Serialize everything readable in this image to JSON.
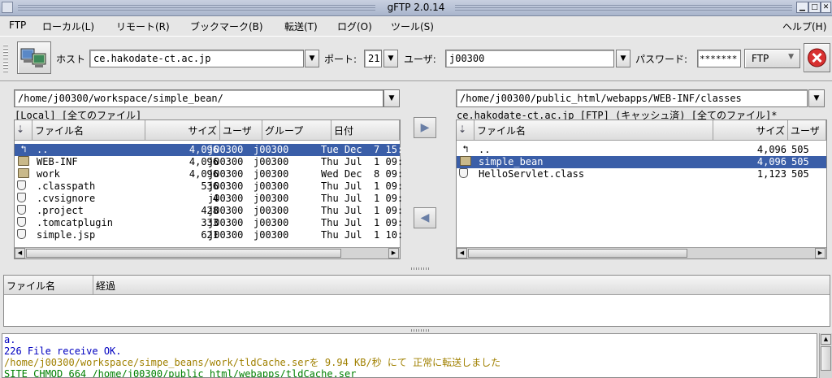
{
  "window": {
    "title": "gFTP 2.0.14"
  },
  "menu": [
    "FTP",
    "ローカル(L)",
    "リモート(R)",
    "ブックマーク(B)",
    "転送(T)",
    "ログ(O)",
    "ツール(S)",
    "ヘルプ(H)"
  ],
  "toolbar": {
    "host_label": "ホスト",
    "host": "ce.hakodate-ct.ac.jp",
    "port_label": "ポート:",
    "port": "21",
    "user_label": "ユーザ:",
    "user": "j00300",
    "password_label": "パスワード:",
    "password": "*******",
    "protocol": "FTP"
  },
  "local": {
    "path": "/home/j00300/workspace/simple_bean/",
    "status": "[Local] [全てのファイル]",
    "columns": [
      "ファイル名",
      "サイズ",
      "ユーザ",
      "グループ",
      "日付"
    ],
    "files": [
      {
        "icon": "up-dir-icon",
        "name": "..",
        "size": "4,096",
        "user": "j00300",
        "group": "j00300",
        "date": "Tue Dec  7 15:"
      },
      {
        "icon": "folder-icon",
        "name": "WEB-INF",
        "size": "4,096",
        "user": "j00300",
        "group": "j00300",
        "date": "Thu Jul  1 09:"
      },
      {
        "icon": "folder-icon",
        "name": "work",
        "size": "4,096",
        "user": "j00300",
        "group": "j00300",
        "date": "Wed Dec  8 09:"
      },
      {
        "icon": "file-icon",
        "name": ".classpath",
        "size": "536",
        "user": "j00300",
        "group": "j00300",
        "date": "Thu Jul  1 09:"
      },
      {
        "icon": "file-icon",
        "name": ".cvsignore",
        "size": "4",
        "user": "j00300",
        "group": "j00300",
        "date": "Thu Jul  1 09:"
      },
      {
        "icon": "file-icon",
        "name": ".project",
        "size": "428",
        "user": "j00300",
        "group": "j00300",
        "date": "Thu Jul  1 09:"
      },
      {
        "icon": "file-icon",
        "name": ".tomcatplugin",
        "size": "333",
        "user": "j00300",
        "group": "j00300",
        "date": "Thu Jul  1 09:"
      },
      {
        "icon": "file-icon",
        "name": "simple.jsp",
        "size": "621",
        "user": "j00300",
        "group": "j00300",
        "date": "Thu Jul  1 10:"
      }
    ]
  },
  "remote": {
    "path": "/home/j00300/public_html/webapps/WEB-INF/classes",
    "status": "ce.hakodate-ct.ac.jp [FTP] (キャッシュ済) [全てのファイル]*",
    "columns": [
      "ファイル名",
      "サイズ",
      "ユーザ"
    ],
    "files": [
      {
        "icon": "up-dir-icon",
        "name": "..",
        "size": "4,096",
        "user": "505"
      },
      {
        "icon": "folder-icon",
        "name": "simple_bean",
        "size": "4,096",
        "user": "505"
      },
      {
        "icon": "file-icon",
        "name": "HelloServlet.class",
        "size": "1,123",
        "user": "505"
      }
    ]
  },
  "transfers": {
    "columns": [
      "ファイル名",
      "経過"
    ]
  },
  "log": [
    {
      "text": "a.",
      "color": "#0000c0"
    },
    {
      "text": "226 File receive OK.",
      "color": "#0000c0"
    },
    {
      "text": "/home/j00300/workspace/simpe_beans/work/tldCache.serを 9.94 KB/秒 にて 正常に転送しました",
      "color": "#a08000"
    },
    {
      "text": "SITE CHMOD 664 /home/j00300/public_html/webapps/tldCache.ser",
      "color": "#008000"
    }
  ]
}
